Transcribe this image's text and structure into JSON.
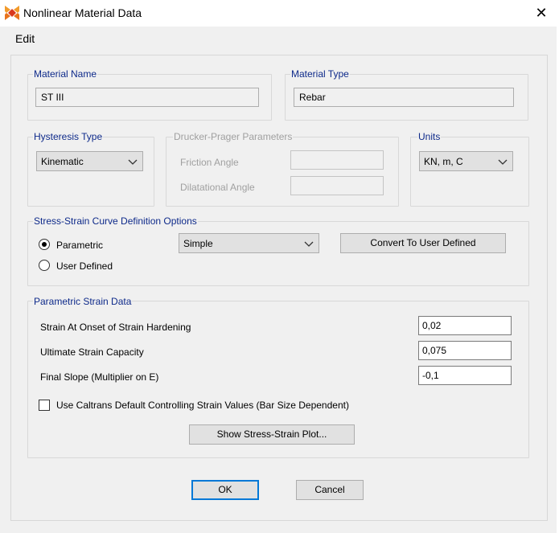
{
  "window": {
    "title": "Nonlinear Material Data",
    "close_glyph": "✕"
  },
  "menu": {
    "edit": "Edit"
  },
  "material_name": {
    "label": "Material Name",
    "value": "ST III"
  },
  "material_type": {
    "label": "Material Type",
    "value": "Rebar"
  },
  "hysteresis": {
    "label": "Hysteresis Type",
    "selected": "Kinematic"
  },
  "drucker_prager": {
    "label": "Drucker-Prager Parameters",
    "friction_angle_label": "Friction Angle",
    "dilatational_angle_label": "Dilatational Angle",
    "friction_angle_value": "",
    "dilatational_angle_value": ""
  },
  "units": {
    "label": "Units",
    "selected": "KN, m, C"
  },
  "curve_options": {
    "label": "Stress-Strain Curve Definition Options",
    "parametric_label": "Parametric",
    "user_defined_label": "User Defined",
    "selected_option": "Parametric",
    "curve_type": "Simple",
    "convert_button": "Convert To User Defined"
  },
  "strain_data": {
    "label": "Parametric Strain Data",
    "rows": [
      {
        "label": "Strain At Onset of Strain Hardening",
        "value": "0,02"
      },
      {
        "label": "Ultimate Strain Capacity",
        "value": "0,075"
      },
      {
        "label": "Final Slope (Multiplier on E)",
        "value": "-0,1"
      }
    ],
    "caltrans_checkbox_label": "Use Caltrans Default Controlling Strain Values  (Bar Size Dependent)",
    "caltrans_checked": false,
    "show_plot_button": "Show Stress-Strain Plot..."
  },
  "footer": {
    "ok": "OK",
    "cancel": "Cancel"
  },
  "icons": {
    "app": "sap2000-app-icon",
    "dropdown": "chevron-down-icon"
  },
  "colors": {
    "group_label": "#0e2a8a",
    "default_button_border": "#0078d7",
    "app_icon": "#e8731c"
  }
}
